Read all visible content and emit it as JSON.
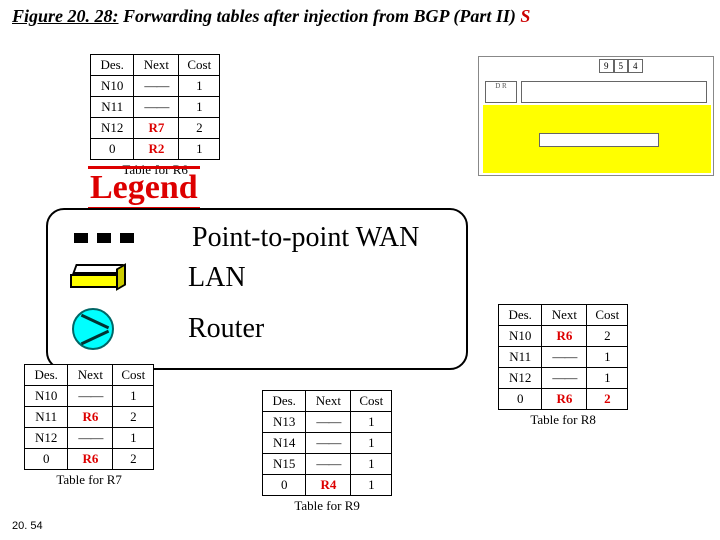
{
  "title_prefix": "Figure 20. 28:",
  "title_main": " Forwarding tables after injection from BGP (Part II) ",
  "title_suffix": "S",
  "page_number": "20. 54",
  "headers": {
    "des": "Des.",
    "next": "Next",
    "cost": "Cost"
  },
  "dash": "——",
  "legend": {
    "word": "Legend",
    "ptp": "Point-to-point WAN",
    "lan": "LAN",
    "router": "Router"
  },
  "tables": {
    "r6": {
      "caption": "Table for R6",
      "rows": [
        {
          "des": "N10",
          "next_dash": true,
          "cost": "1"
        },
        {
          "des": "N11",
          "next_dash": true,
          "cost": "1"
        },
        {
          "des": "N12",
          "next": "R7",
          "next_red": true,
          "cost": "2"
        },
        {
          "des": "0",
          "next": "R2",
          "next_red": true,
          "cost": "1"
        }
      ]
    },
    "r7": {
      "caption": "Table for R7",
      "rows": [
        {
          "des": "N10",
          "next_dash": true,
          "cost": "1"
        },
        {
          "des": "N11",
          "next": "R6",
          "next_red": true,
          "cost": "2"
        },
        {
          "des": "N12",
          "next_dash": true,
          "cost": "1"
        },
        {
          "des": "0",
          "next": "R6",
          "next_red": true,
          "cost": "2"
        }
      ]
    },
    "r8": {
      "caption": "Table for R8",
      "rows": [
        {
          "des": "N10",
          "next": "R6",
          "next_red": true,
          "cost": "2"
        },
        {
          "des": "N11",
          "next_dash": true,
          "cost": "1"
        },
        {
          "des": "N12",
          "next_dash": true,
          "cost": "1"
        },
        {
          "des": "0",
          "next": "R6",
          "next_red": true,
          "cost": "2",
          "cost_red": true
        }
      ]
    },
    "r9": {
      "caption": "Table for R9",
      "rows": [
        {
          "des": "N13",
          "next_dash": true,
          "cost": "1"
        },
        {
          "des": "N14",
          "next_dash": true,
          "cost": "1"
        },
        {
          "des": "N15",
          "next_dash": true,
          "cost": "1"
        },
        {
          "des": "0",
          "next": "R4",
          "next_red": true,
          "cost": "1"
        }
      ]
    }
  }
}
